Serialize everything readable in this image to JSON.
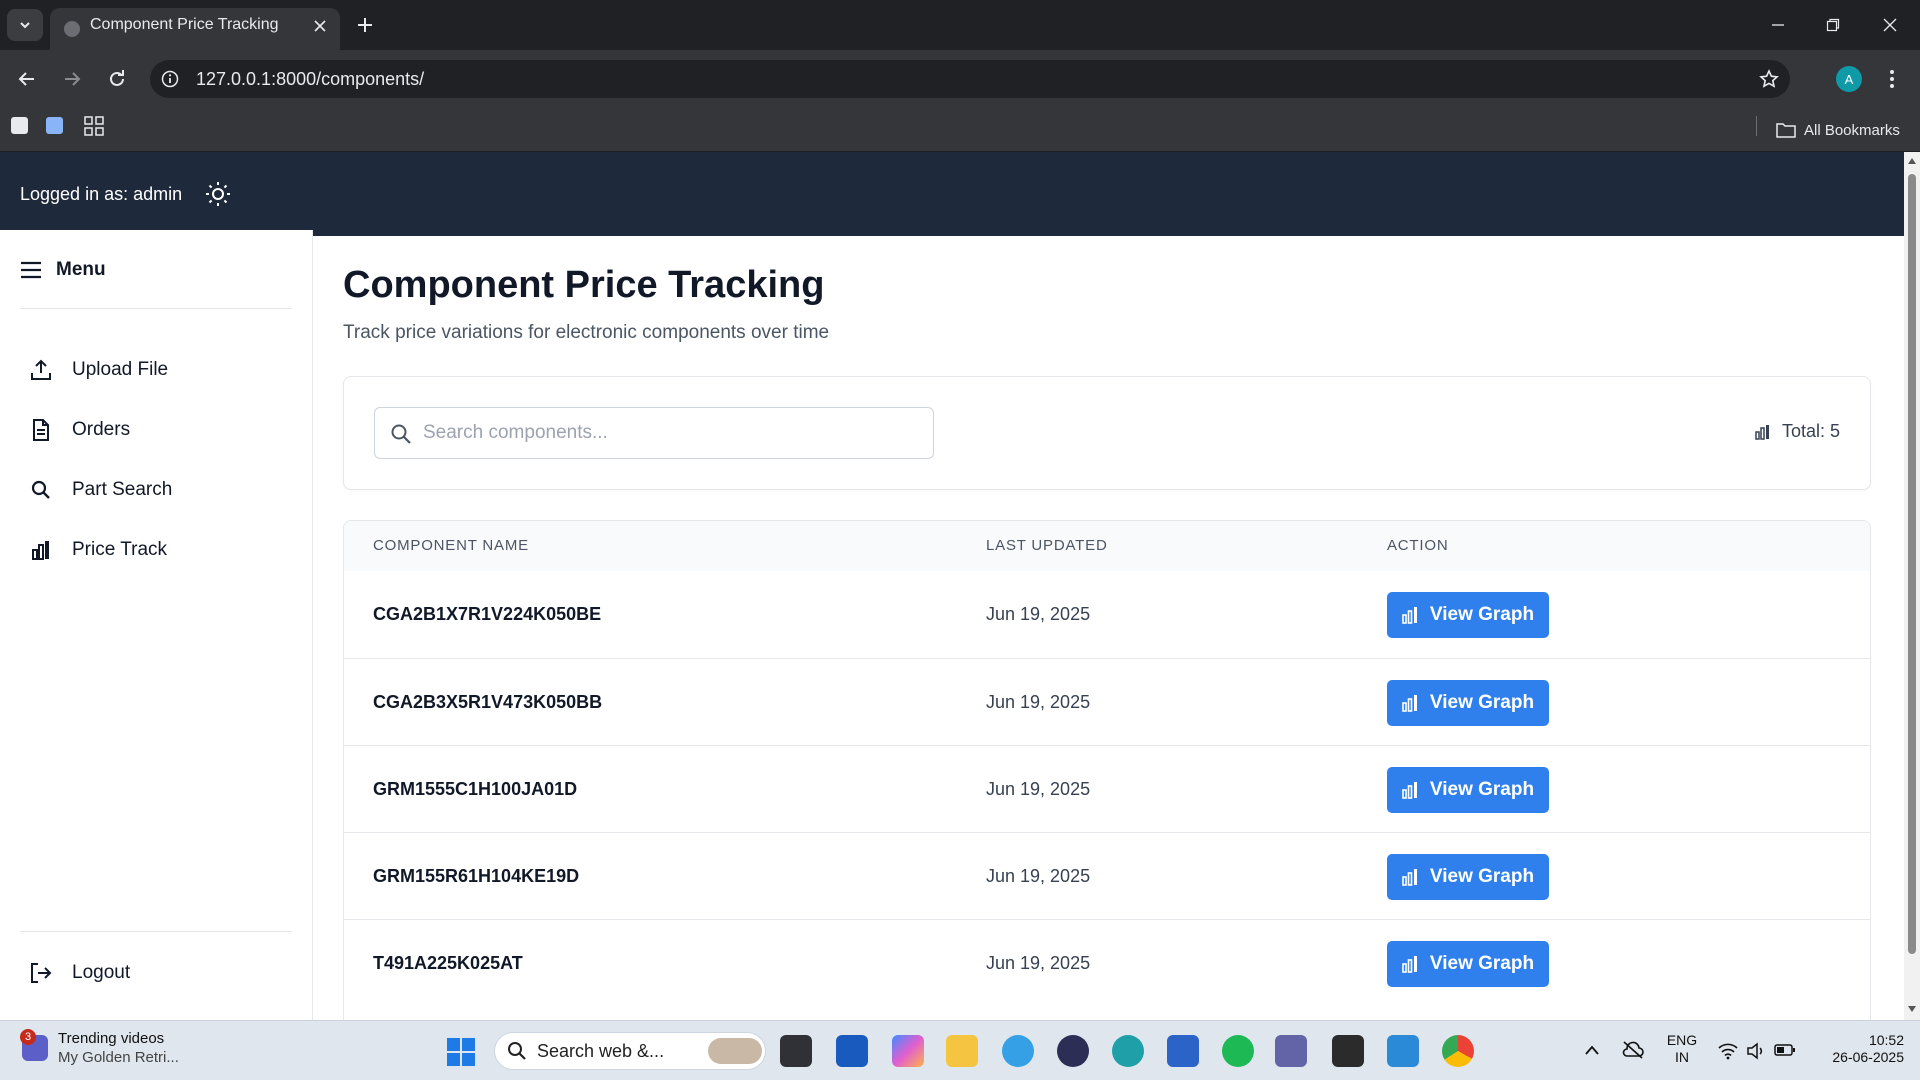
{
  "browser": {
    "tab_title": "Component Price Tracking",
    "url": "127.0.0.1:8000/components/",
    "profile_initial": "A",
    "bookmarks_label": "All Bookmarks"
  },
  "header": {
    "logged_in_text": "Logged in as: admin"
  },
  "sidebar": {
    "menu_label": "Menu",
    "items": [
      {
        "label": "Upload File",
        "icon": "upload-icon"
      },
      {
        "label": "Orders",
        "icon": "document-icon"
      },
      {
        "label": "Part Search",
        "icon": "search-icon"
      },
      {
        "label": "Price Track",
        "icon": "chart-icon"
      }
    ],
    "logout_label": "Logout"
  },
  "main": {
    "title": "Component Price Tracking",
    "subtitle": "Track price variations for electronic components over time",
    "search_placeholder": "Search components...",
    "total_label": "Total: 5",
    "table": {
      "headers": [
        "COMPONENT NAME",
        "LAST UPDATED",
        "ACTION"
      ],
      "rows": [
        {
          "name": "CGA2B1X7R1V224K050BE",
          "updated": "Jun 19, 2025",
          "action": "View Graph"
        },
        {
          "name": "CGA2B3X5R1V473K050BB",
          "updated": "Jun 19, 2025",
          "action": "View Graph"
        },
        {
          "name": "GRM1555C1H100JA01D",
          "updated": "Jun 19, 2025",
          "action": "View Graph"
        },
        {
          "name": "GRM155R61H104KE19D",
          "updated": "Jun 19, 2025",
          "action": "View Graph"
        },
        {
          "name": "T491A225K025AT",
          "updated": "Jun 19, 2025",
          "action": "View Graph"
        }
      ]
    }
  },
  "taskbar": {
    "news_badge": "3",
    "news_title": "Trending videos",
    "news_subtitle": "My Golden Retri...",
    "search_text": "Search web &...",
    "lang_top": "ENG",
    "lang_bottom": "IN",
    "time": "10:52",
    "date": "26-06-2025"
  },
  "colors": {
    "header_bg": "#1e293b",
    "primary_button": "#2f80ed",
    "browser_dark": "#202124"
  }
}
